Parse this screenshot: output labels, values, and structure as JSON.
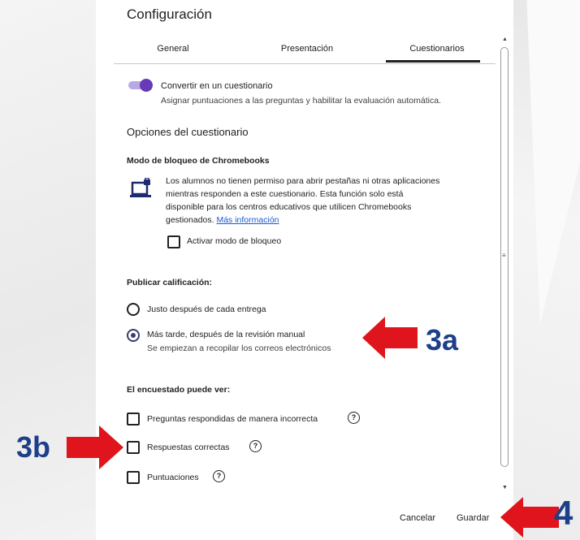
{
  "dialog": {
    "title": "Configuración",
    "tabs": [
      {
        "label": "General"
      },
      {
        "label": "Presentación"
      },
      {
        "label": "Cuestionarios",
        "active": true
      }
    ]
  },
  "quiz_toggle": {
    "label": "Convertir en un cuestionario",
    "description": "Asignar puntuaciones a las preguntas y habilitar la evaluación automática.",
    "on": true
  },
  "quiz_options": {
    "heading": "Opciones del cuestionario",
    "lock_mode": {
      "title": "Modo de bloqueo de Chromebooks",
      "lines": [
        "Los alumnos no tienen permiso para abrir pestañas ni otras aplicaciones",
        "mientras responden a este cuestionario. Esta función solo está",
        "disponible para los centros educativos que utilicen Chromebooks",
        "gestionados."
      ],
      "more_info": "Más información",
      "checkbox_label": "Activar modo de bloqueo",
      "checked": false
    }
  },
  "publish": {
    "heading": "Publicar calificación:",
    "options": [
      {
        "label": "Justo después de cada entrega",
        "selected": false
      },
      {
        "label": "Más tarde, después de la revisión manual",
        "sub": "Se empiezan a recopilar los correos electrónicos",
        "selected": true
      }
    ]
  },
  "respondent": {
    "heading": "El encuestado puede ver:",
    "options": [
      {
        "label": "Preguntas respondidas de manera incorrecta",
        "checked": false
      },
      {
        "label": "Respuestas correctas",
        "checked": false
      },
      {
        "label": "Puntuaciones",
        "checked": false
      }
    ]
  },
  "footer": {
    "cancel": "Cancelar",
    "save": "Guardar"
  },
  "annotations": {
    "a": "3a",
    "b": "3b",
    "c": "4",
    "arrow_color": "#e0141c",
    "label_color": "#1d3f8a"
  },
  "colors": {
    "accent": "#673ab7",
    "link": "#1a5ad1"
  }
}
